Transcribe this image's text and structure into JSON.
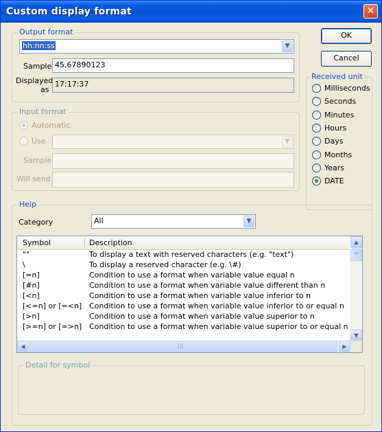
{
  "window": {
    "title": "Custom display format"
  },
  "output_format": {
    "legend": "Output format",
    "format_value": "hh:nn:ss",
    "sample_label": "Sample",
    "sample_value": "45,67890123",
    "displayed_label_1": "Displayed",
    "displayed_label_2": "as",
    "displayed_value": "17:17:37"
  },
  "buttons": {
    "ok": "OK",
    "cancel": "Cancel"
  },
  "received_unit": {
    "legend": "Received unit",
    "options": [
      "Milliseconds",
      "Seconds",
      "Minutes",
      "Hours",
      "Days",
      "Months",
      "Years",
      "DATE"
    ],
    "selected": "DATE"
  },
  "input_format": {
    "legend": "Input format",
    "automatic_label": "Automatic",
    "use_label": "Use",
    "use_value": "",
    "sample_label": "Sample",
    "sample_value": "",
    "will_send_label": "Will send",
    "will_send_value": ""
  },
  "help": {
    "legend": "Help",
    "category_label": "Category",
    "category_value": "All",
    "columns": {
      "symbol": "Symbol",
      "description": "Description"
    },
    "rows": [
      {
        "symbol": "\"\"",
        "description": "To display a text with reserved characters (e.g. \"text\")"
      },
      {
        "symbol": "\\",
        "description": "To display a reserved character (e.g. \\#)"
      },
      {
        "symbol": "[=n]",
        "description": "Condition to use a format when variable value equal n"
      },
      {
        "symbol": "[#n]",
        "description": "Condition to use a format when variable value different than n"
      },
      {
        "symbol": "[<n]",
        "description": "Condition to use a format when variable value inferior to n"
      },
      {
        "symbol": "[<=n] or [=<n]",
        "description": "Condition to use a format when variable value inferior to or equal n"
      },
      {
        "symbol": "[>n]",
        "description": "Condition to use a format when variable value superior to n"
      },
      {
        "symbol": "[>=n] or [=>n]",
        "description": "Condition to use a format when variable value superior to or equal n"
      }
    ],
    "detail_legend": "Detail for symbol"
  }
}
